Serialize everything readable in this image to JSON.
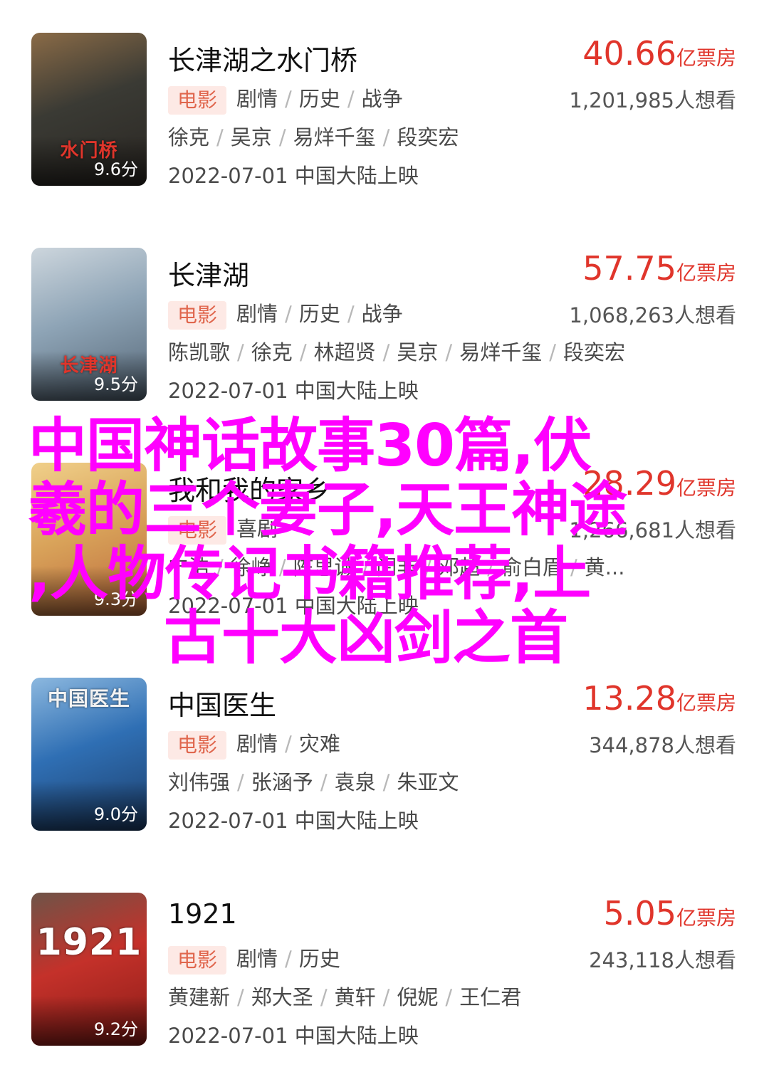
{
  "movies": [
    {
      "title": "长津湖之水门桥",
      "box_num": "40.66",
      "box_unit": "亿票房",
      "badge": "电影",
      "genres": [
        "剧情",
        "历史",
        "战争"
      ],
      "want": "1,201,985人想看",
      "cast": [
        "徐克",
        "吴京",
        "易烊千玺",
        "段奕宏"
      ],
      "date": "2022-07-01 中国大陆上映",
      "score": "9.6分",
      "poster_text": "水门桥",
      "colors": {
        "a": "#3a3a34",
        "b": "#8a6b47",
        "c": "#2a2622"
      }
    },
    {
      "title": "长津湖",
      "box_num": "57.75",
      "box_unit": "亿票房",
      "badge": "电影",
      "genres": [
        "剧情",
        "历史",
        "战争"
      ],
      "want": "1,068,263人想看",
      "cast": [
        "陈凯歌",
        "徐克",
        "林超贤",
        "吴京",
        "易烊千玺",
        "段奕宏"
      ],
      "date": "2022-07-01 中国大陆上映",
      "score": "9.5分",
      "poster_text": "长津湖",
      "colors": {
        "a": "#8ea4b6",
        "b": "#cdd6dd",
        "c": "#556676"
      }
    },
    {
      "title": "我和我的家乡",
      "box_num": "28.29",
      "box_unit": "亿票房",
      "badge": "电影",
      "genres": [
        "喜剧"
      ],
      "want": "1,266,681人想看",
      "cast": [
        "宁浩",
        "徐峥",
        "陈思诚",
        "闫非",
        "邓超",
        "俞白眉",
        "黄..."
      ],
      "date": "2022-07-01 中国大陆上映",
      "score": "9.3分",
      "poster_text": "",
      "colors": {
        "a": "#d9a35a",
        "b": "#f0d08a",
        "c": "#b9673a"
      }
    },
    {
      "title": "中国医生",
      "box_num": "13.28",
      "box_unit": "亿票房",
      "badge": "电影",
      "genres": [
        "剧情",
        "灾难"
      ],
      "want": "344,878人想看",
      "cast": [
        "刘伟强",
        "张涵予",
        "袁泉",
        "朱亚文"
      ],
      "date": "2022-07-01 中国大陆上映",
      "score": "9.0分",
      "poster_text": "中国医生",
      "colors": {
        "a": "#2f6fb4",
        "b": "#8cb8df",
        "c": "#1d3e6a"
      }
    },
    {
      "title": "1921",
      "box_num": "5.05",
      "box_unit": "亿票房",
      "badge": "电影",
      "genres": [
        "剧情",
        "历史"
      ],
      "want": "243,118人想看",
      "cast": [
        "黄建新",
        "郑大圣",
        "黄轩",
        "倪妮",
        "王仁君"
      ],
      "date": "2022-07-01 中国大陆上映",
      "score": "9.2分",
      "poster_text": "1921",
      "colors": {
        "a": "#c4312a",
        "b": "#6e5448",
        "c": "#8a1c17"
      }
    }
  ],
  "overlay": {
    "line1": "中国神话故事30篇,伏",
    "line2": "羲的三个妻子,天王神途",
    "line3": ",人物传记书籍推荐,上",
    "line4": "古十大凶剑之首"
  }
}
